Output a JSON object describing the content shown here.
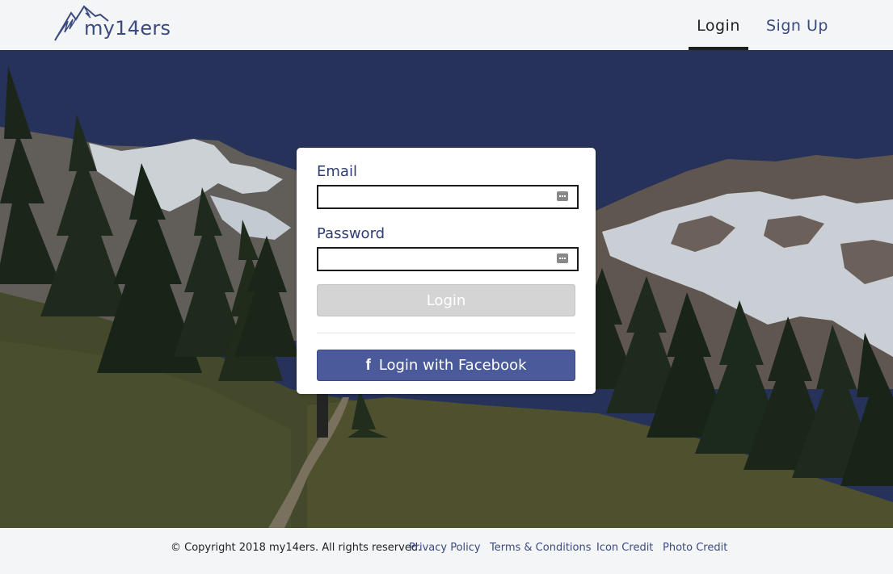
{
  "header": {
    "logo_text": "my14ers",
    "nav": {
      "login_label": "Login",
      "signup_label": "Sign Up"
    }
  },
  "login_form": {
    "email_label": "Email",
    "email_value": "",
    "password_label": "Password",
    "password_value": "",
    "login_button_label": "Login",
    "facebook_icon": "f",
    "facebook_button_label": "Login with Facebook"
  },
  "footer": {
    "copyright": "© Copyright 2018 my14ers. All rights reserved.",
    "links": {
      "privacy": "Privacy Policy",
      "terms": "Terms & Conditions",
      "icon_credit": "Icon Credit",
      "photo_credit": "Photo Credit"
    }
  },
  "colors": {
    "brand": "#3b4a7f",
    "facebook": "#4a5a9b",
    "login_button_disabled": "#d4d4d4"
  }
}
